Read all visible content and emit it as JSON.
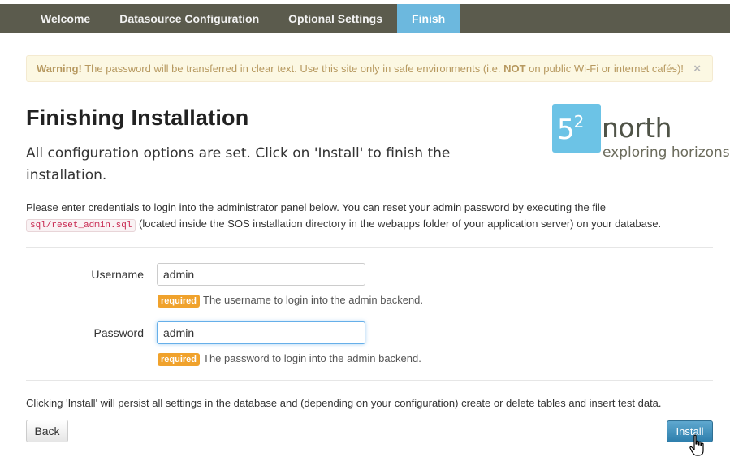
{
  "nav": {
    "tabs": [
      {
        "label": "Welcome",
        "active": false
      },
      {
        "label": "Datasource Configuration",
        "active": false
      },
      {
        "label": "Optional Settings",
        "active": false
      },
      {
        "label": "Finish",
        "active": true
      }
    ]
  },
  "alert": {
    "strong": "Warning!",
    "text_1": " The password will be transferred in clear text. Use this site only in safe environments (i.e. ",
    "not": "NOT",
    "text_2": " on public Wi-Fi or internet cafés)!",
    "close": "×"
  },
  "header": {
    "title": "Finishing Installation",
    "subtitle": "All configuration options are set. Click on 'Install' to finish the installation."
  },
  "logo": {
    "number": "5",
    "number_sup": "2",
    "word": "north",
    "tagline": "exploring horizons"
  },
  "intro": {
    "text_1": "Please enter credentials to login into the administrator panel below. You can reset your admin password by executing the file ",
    "code": "sql/reset_admin.sql",
    "text_2": " (located inside the SOS installation directory in the webapps folder of your application server) on your database."
  },
  "form": {
    "username": {
      "label": "Username",
      "value": "admin",
      "badge": "required",
      "help": "The username to login into the admin backend."
    },
    "password": {
      "label": "Password",
      "value": "admin",
      "badge": "required",
      "help": "The password to login into the admin backend."
    }
  },
  "footer": {
    "text": "Clicking 'Install' will persist all settings in the database and (depending on your configuration) create or delete tables and insert test data.",
    "back_label": "Back",
    "install_label": "Install"
  },
  "colors": {
    "nav_bg": "#5b5b4d",
    "active_tab": "#6cb8de",
    "alert_bg": "#fcf8e3",
    "badge": "#f0a22c",
    "install_button": "#2e7fad"
  }
}
